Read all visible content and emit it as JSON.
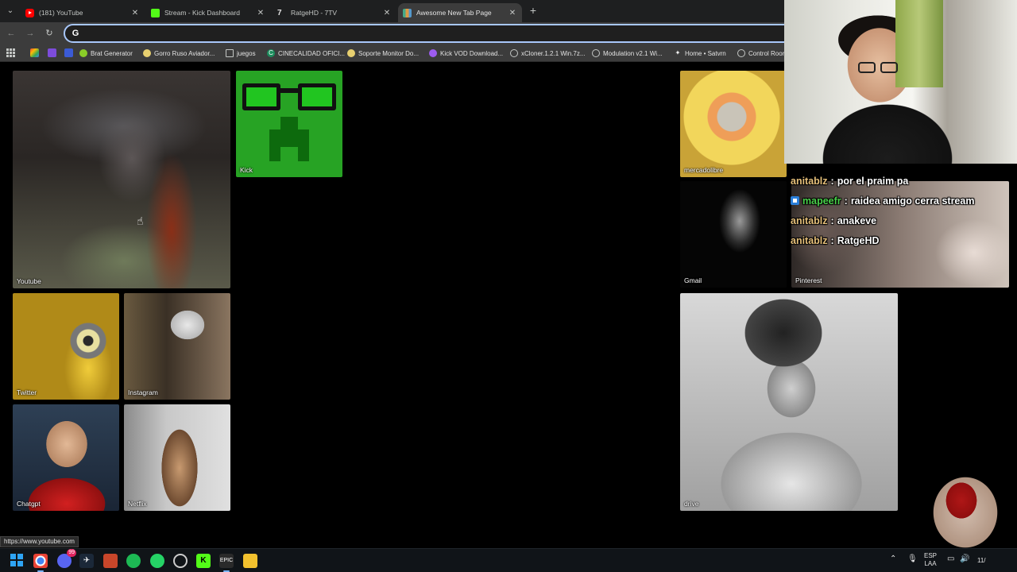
{
  "browser": {
    "tabs": [
      {
        "title": "(181) YouTube",
        "favicon": "youtube-icon",
        "active": false
      },
      {
        "title": "Stream - Kick Dashboard",
        "favicon": "kick-icon",
        "active": false
      },
      {
        "title": "RatgeHD - 7TV",
        "favicon": "7tv-icon",
        "active": false
      },
      {
        "title": "Awesome New Tab Page",
        "favicon": "new-tab-grid-icon",
        "active": true
      }
    ],
    "omnibox": {
      "value": "",
      "search_engine": "G"
    },
    "bookmarks": [
      {
        "label": "Brat Generator",
        "icon": "brat-icon"
      },
      {
        "label": "Gorro Ruso Aviador...",
        "icon": "bookmark-icon"
      },
      {
        "label": "juegos",
        "icon": "folder-icon"
      },
      {
        "label": "CINECALIDAD OFICI...",
        "icon": "cine-icon"
      },
      {
        "label": "Soporte Monitor Do...",
        "icon": "bookmark-icon"
      },
      {
        "label": "Kick VOD Download...",
        "icon": "kick-vod-icon"
      },
      {
        "label": "xCloner.1.2.1 Win.7z...",
        "icon": "globe-icon"
      },
      {
        "label": "Modulation v2.1 Wi...",
        "icon": "globe-icon"
      },
      {
        "label": "Home • Satvrn",
        "icon": "star-icon"
      },
      {
        "label": "Control Roor",
        "icon": "control-icon"
      }
    ],
    "status_url": "https://www.youtube.com"
  },
  "shortcuts": {
    "youtube": "Youtube",
    "kick": "Kick",
    "mercadolibre": "mercadolibre",
    "gmail": "Gmail",
    "pinterest": "Pinterest",
    "twitter": "Twitter",
    "instagram": "Instagram",
    "chatgpt": "Chatgpt",
    "netflix": "Netflix",
    "drive": "drive"
  },
  "chat": [
    {
      "user": "anitablz",
      "sep": ":",
      "message": "por el praim pa",
      "color": "#e6c07a",
      "badge": false
    },
    {
      "user": "mapeefr",
      "sep": ":",
      "message": "raidea amigo cerra stream",
      "color": "#49d04a",
      "badge": true
    },
    {
      "user": "anitablz",
      "sep": ":",
      "message": "anakeve",
      "color": "#e6c07a",
      "badge": false
    },
    {
      "user": "anitablz",
      "sep": ":",
      "message": "RatgeHD",
      "color": "#e6c07a",
      "badge": false
    }
  ],
  "taskbar": {
    "lang_top": "ESP",
    "lang_bottom": "LAA",
    "clock": "11/",
    "discord_badge": "99"
  },
  "colors": {
    "tab_active": "#3c3c3c",
    "omnibox_focus": "#a8c7fa",
    "kick_green": "#53fc18"
  }
}
